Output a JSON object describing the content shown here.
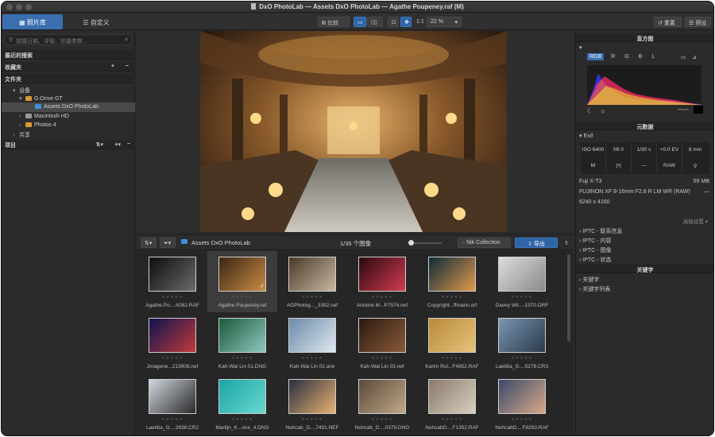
{
  "window": {
    "title": "DxO PhotoLab — Assets DxO PhotoLab — Agathe Poupeney.raf (M)"
  },
  "toolbar": {
    "tab_library": "照片库",
    "tab_customize": "自定义",
    "compare_label": "比较",
    "one_to_one": "1:1",
    "zoom": "22 %",
    "reset_label": "重置",
    "preset_label": "预设"
  },
  "left": {
    "search_placeholder": "按摄日期、评级、拍摄参数...",
    "recent_searches": "最近的搜索",
    "favorites": "收藏夹",
    "folders": "文件夹",
    "devices": "设备",
    "drive": "G-Drive GT",
    "assets_folder": "Assets DxO PhotoLab",
    "macintosh": "Macintosh HD",
    "photos": "Photos 4",
    "shared": "共享",
    "projects": "项目"
  },
  "filmstrip": {
    "folder_name": "Assets DxO PhotoLab",
    "count": "1/35 个图像",
    "nik_label": "Nik Collection",
    "export_label": "导出",
    "items": [
      {
        "name": "Agathe Po....A062.RAF",
        "selected": false
      },
      {
        "name": "Agathe Poupeney.raf",
        "selected": true
      },
      {
        "name": "AGPhotog..._3392.nef",
        "selected": false
      },
      {
        "name": "Antoine M...P7574.nef",
        "selected": false
      },
      {
        "name": "Copyright...ffmann.orf",
        "selected": false
      },
      {
        "name": "Davey Wil...-1370.ORF",
        "selected": false
      },
      {
        "name": "Jmagerie...213908.nef",
        "selected": false
      },
      {
        "name": "Kah-Wai Lin 01.DNG",
        "selected": false
      },
      {
        "name": "Kah-Wai Lin 02.arw",
        "selected": false
      },
      {
        "name": "Kah-Wai Lin 03.nef",
        "selected": false
      },
      {
        "name": "Karim Rol...F4952.RAF",
        "selected": false
      },
      {
        "name": "Laetitia_G....5278.CR3",
        "selected": false
      },
      {
        "name": "Laetitia_G....2838.CR2",
        "selected": false
      },
      {
        "name": "Martijn_K...one_4.DNG",
        "selected": false
      },
      {
        "name": "Nohcab_D....7491.NEF",
        "selected": false
      },
      {
        "name": "Nohcab_D....0379.DNG",
        "selected": false
      },
      {
        "name": "NohcabD....F1352.RAF",
        "selected": false
      },
      {
        "name": "NohcabD....F8293.RAF",
        "selected": false
      }
    ]
  },
  "right": {
    "histogram_title": "直方图",
    "channels": [
      "RGB",
      "R",
      "G",
      "B",
      "L"
    ],
    "metadata_title": "元数据",
    "exif_label": "Exif",
    "exif_iso": "ISO 6400",
    "exif_aperture": "f/8.0",
    "exif_shutter": "1/30 s",
    "exif_ev": "+0.0 EV",
    "exif_focal": "8 mm",
    "exif_mode": "M",
    "exif_dash": "—",
    "exif_raw": "RAW",
    "camera": "Fuji X-T3",
    "size": "59 MB",
    "lens": "FUJINON XF 8-16mm F2.8 R LM WR (RAW)",
    "lens_dash": "—",
    "dimensions": "6240 x 4160",
    "advanced": "高级设置",
    "iptc_contact": "IPTC - 联系信息",
    "iptc_content": "IPTC - 内容",
    "iptc_image": "IPTC - 图像",
    "iptc_status": "IPTC - 状态",
    "keywords_title": "关键字",
    "keywords": "关键字",
    "keyword_list": "关键字列表"
  }
}
